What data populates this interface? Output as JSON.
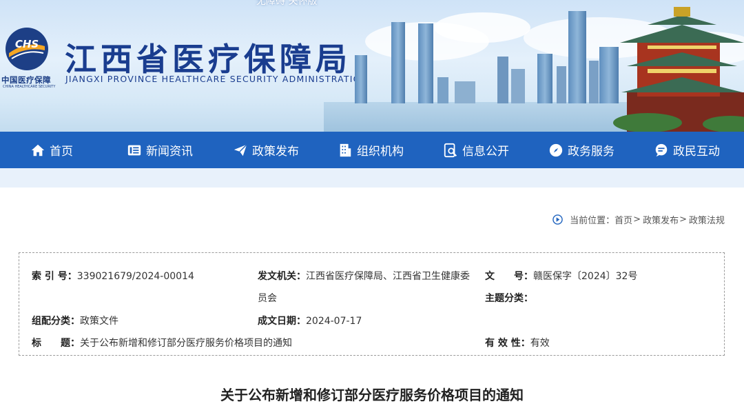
{
  "header": {
    "accessibility_link": "无障碍 关怀版",
    "logo_cn": "中国医疗保障",
    "logo_en": "CHINA HEALTHCARE SECURITY",
    "logo_mark": "CHS",
    "title": "江西省医疗保障局",
    "subtitle": "JIANGXI PROVINCE HEALTHCARE SECURITY ADMINISTRATION"
  },
  "nav": {
    "items": [
      {
        "label": "首页",
        "icon": "home-icon"
      },
      {
        "label": "新闻资讯",
        "icon": "news-icon"
      },
      {
        "label": "政策发布",
        "icon": "paper-plane-icon"
      },
      {
        "label": "组织机构",
        "icon": "building-icon"
      },
      {
        "label": "信息公开",
        "icon": "search-doc-icon"
      },
      {
        "label": "政务服务",
        "icon": "compass-icon"
      },
      {
        "label": "政民互动",
        "icon": "chat-icon"
      }
    ]
  },
  "breadcrumb": {
    "prefix": "当前位置：",
    "items": [
      "首页",
      "政策发布",
      "政策法规"
    ],
    "separator": ">"
  },
  "info": {
    "index_label": "索 引 号：",
    "index_value": "339021679/2024-00014",
    "issuer_label": "发文机关：",
    "issuer_value_line1": "江西省医疗保障局、江西省卫生健康委",
    "issuer_value_line2": "员会",
    "docno_label": "文　　号：",
    "docno_value": "赣医保字〔2024〕32号",
    "topic_label": "主题分类：",
    "topic_value": "",
    "category_label": "组配分类：",
    "category_value": "政策文件",
    "date_label": "成文日期：",
    "date_value": "2024-07-17",
    "title_label": "标　　题：",
    "title_value": "关于公布新增和修订部分医疗服务价格项目的通知",
    "validity_label": "有 效 性：",
    "validity_value": "有效"
  },
  "document": {
    "title": "关于公布新增和修订部分医疗服务价格项目的通知"
  },
  "colors": {
    "nav_bg": "#1f63bf",
    "title_blue": "#1a3d8f",
    "strip_bg": "#e8f1fb"
  }
}
